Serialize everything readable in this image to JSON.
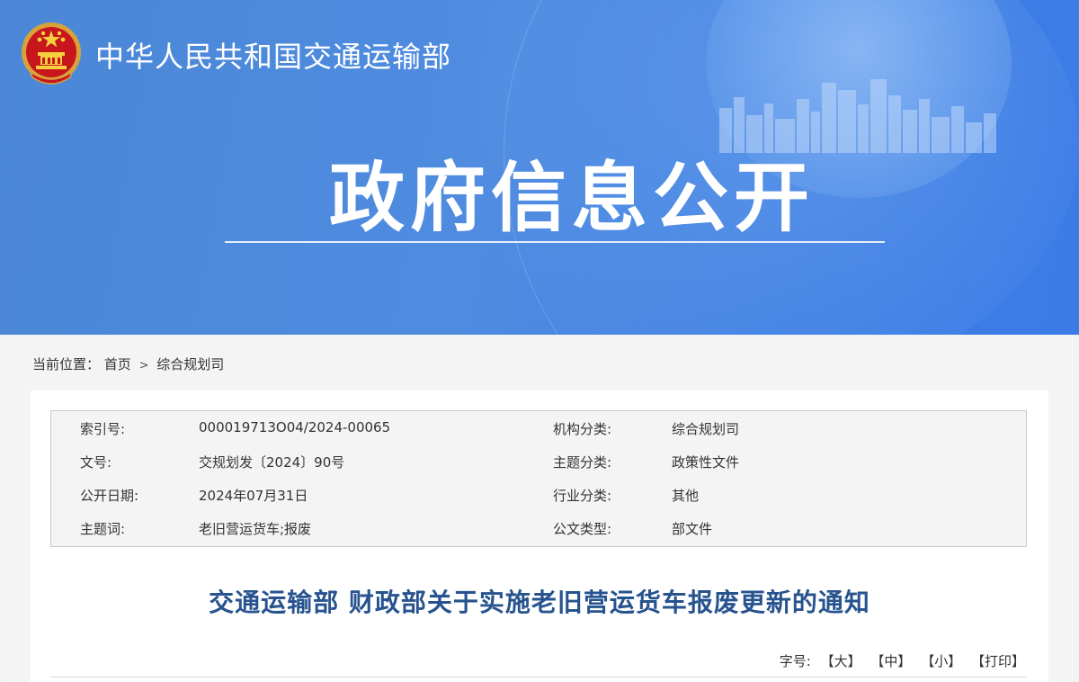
{
  "header": {
    "site_title": "中华人民共和国交通运输部",
    "hero_title": "政府信息公开",
    "emblem_icon": "national-emblem-icon"
  },
  "breadcrumb": {
    "label": "当前位置：",
    "items": [
      "首页",
      "综合规划司"
    ],
    "separator": ">"
  },
  "metadata": {
    "rows": [
      {
        "k1": "索引号:",
        "v1": "000019713O04/2024-00065",
        "k2": "机构分类:",
        "v2": "综合规划司"
      },
      {
        "k1": "文号:",
        "v1": "交规划发〔2024〕90号",
        "k2": "主题分类:",
        "v2": "政策性文件"
      },
      {
        "k1": "公开日期:",
        "v1": "2024年07月31日",
        "k2": "行业分类:",
        "v2": "其他"
      },
      {
        "k1": "主题词:",
        "v1": "老旧营运货车;报废",
        "k2": "公文类型:",
        "v2": "部文件"
      }
    ]
  },
  "document": {
    "title": "交通运输部 财政部关于实施老旧营运货车报废更新的通知"
  },
  "font_size_bar": {
    "label": "字号:",
    "options": [
      "【大】",
      "【中】",
      "【小】",
      "【打印】"
    ]
  },
  "colors": {
    "banner_blue": "#4b87d6",
    "title_blue": "#27538f"
  }
}
